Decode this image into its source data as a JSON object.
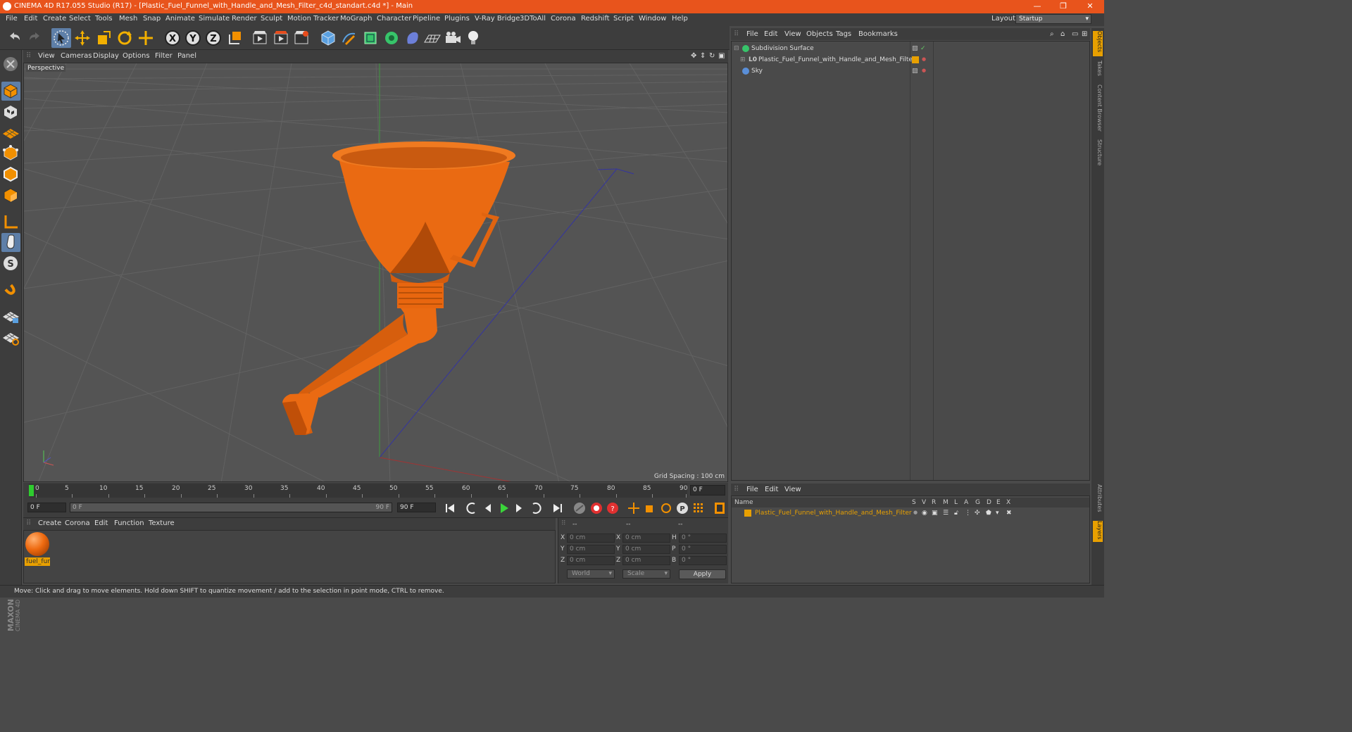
{
  "window": {
    "title": "CINEMA 4D R17.055 Studio (R17) - [Plastic_Fuel_Funnel_with_Handle_and_Mesh_Filter_c4d_standart.c4d *] - Main",
    "minimize": "—",
    "restore": "❐",
    "close": "✕"
  },
  "menu": [
    "File",
    "Edit",
    "Create",
    "Select",
    "Tools",
    "Mesh",
    "Snap",
    "Animate",
    "Simulate",
    "Render",
    "Sculpt",
    "Motion Tracker",
    "MoGraph",
    "Character",
    "Pipeline",
    "Plugins",
    "V-Ray Bridge",
    "3DToAll",
    "Corona",
    "Redshift",
    "Script",
    "Window",
    "Help"
  ],
  "layout": {
    "label": "Layout:",
    "value": "Startup"
  },
  "toolbar": {
    "axis_x": "X",
    "axis_y": "Y",
    "axis_z": "Z"
  },
  "viewport": {
    "menu": [
      "View",
      "Cameras",
      "Display",
      "Options",
      "Filter",
      "Panel"
    ],
    "label": "Perspective",
    "grid_spacing": "Grid Spacing : 100 cm"
  },
  "timeline": {
    "ticks": [
      "0",
      "5",
      "10",
      "15",
      "20",
      "25",
      "30",
      "35",
      "40",
      "45",
      "50",
      "55",
      "60",
      "65",
      "70",
      "75",
      "80",
      "85",
      "90"
    ],
    "current_frame": "0 F",
    "start_field": "0 F",
    "range_start": "0 F",
    "range_end": "90 F",
    "end_field": "90 F"
  },
  "material_manager": {
    "menu": [
      "Create",
      "Corona",
      "Edit",
      "Function",
      "Texture"
    ],
    "material_name": "fuel_fur"
  },
  "coordinates": {
    "header": [
      "--",
      "--",
      "--"
    ],
    "rows": [
      {
        "pos_label": "X",
        "pos": "0 cm",
        "size_label": "X",
        "size": "0 cm",
        "rot_label": "H",
        "rot": "0 °"
      },
      {
        "pos_label": "Y",
        "pos": "0 cm",
        "size_label": "Y",
        "size": "0 cm",
        "rot_label": "P",
        "rot": "0 °"
      },
      {
        "pos_label": "Z",
        "pos": "0 cm",
        "size_label": "Z",
        "size": "0 cm",
        "rot_label": "B",
        "rot": "0 °"
      }
    ],
    "mode_world": "World",
    "mode_scale": "Scale",
    "apply": "Apply"
  },
  "status": "Move: Click and drag to move elements. Hold down SHIFT to quantize movement / add to the selection in point mode, CTRL to remove.",
  "object_manager": {
    "menu": [
      "File",
      "Edit",
      "View",
      "Objects",
      "Tags",
      "Bookmarks"
    ],
    "objects": [
      {
        "name": "Subdivision Surface",
        "icon_color": "#37c46a"
      },
      {
        "name": "Plastic_Fuel_Funnel_with_Handle_and_Mesh_Filter",
        "icon_color": "#bbbbbb"
      },
      {
        "name": "Sky",
        "icon_color": "#5a8fd8"
      }
    ]
  },
  "layer_manager": {
    "menu": [
      "File",
      "Edit",
      "View"
    ],
    "columns": [
      "Name",
      "S",
      "V",
      "R",
      "M",
      "L",
      "A",
      "G",
      "D",
      "E",
      "X"
    ],
    "layers": [
      {
        "name": "Plastic_Fuel_Funnel_with_Handle_and_Mesh_Filter",
        "color": "#e8a000"
      }
    ]
  },
  "right_tabs": [
    "Objects",
    "Takes",
    "Content Browser",
    "Structure"
  ],
  "right_tabs_lower": [
    "Attributes",
    "Layers"
  ],
  "colors": {
    "accent": "#e8541c",
    "selected": "#5e7fa8",
    "material": "#ee6a10",
    "layer": "#e8a000"
  }
}
